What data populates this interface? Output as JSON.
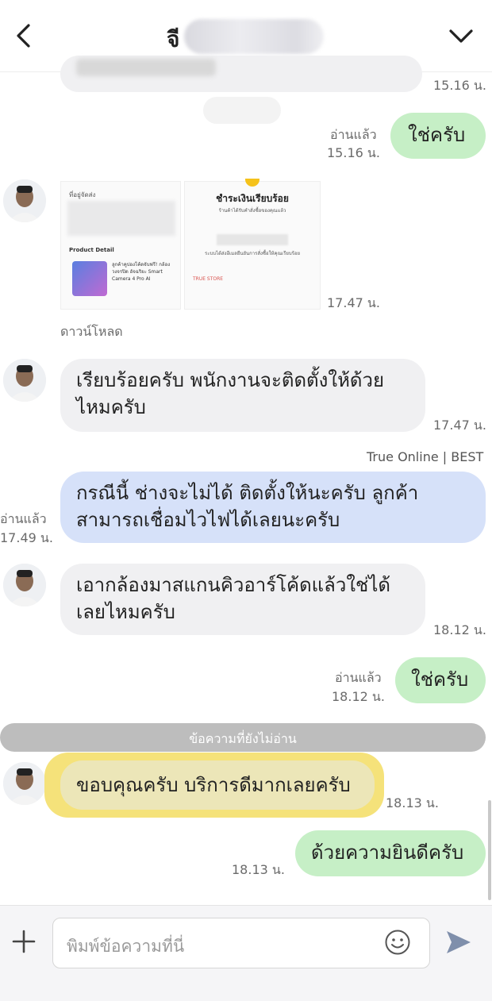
{
  "header": {
    "title_visible": "จี",
    "back_icon": "chevron-left-icon",
    "menu_icon": "chevron-down-icon"
  },
  "messages": {
    "top_partial_time": "15.16 น.",
    "m1": {
      "text": "ใช่ครับ",
      "read": "อ่านแล้ว",
      "time": "15.16 น."
    },
    "images": {
      "time": "17.47 น.",
      "download_label": "ดาวน์โหลด",
      "left_card": {
        "title": "ที่อยู่จัดส่ง",
        "section": "Product Detail",
        "product_name": "ลูกค้าคูปองโค้ดจับฟรี! กล้องวงจรปิด อัจฉริยะ Smart Camera 4 Pro AI"
      },
      "right_card": {
        "title": "ชำระเงินเรียบร้อย",
        "line1": "ร้านค้าได้รับคำสั่งซื้อของคุณแล้ว",
        "line2": "ระบบได้ส่งอีเมลยืนยันการสั่งซื้อให้คุณเรียบร้อย",
        "line3": "TRUE STORE"
      }
    },
    "m2": {
      "text_line1": "เรียบร้อยครับ พนักงานจะติดตั้งให้ด้วย",
      "text_line2": "ไหมครับ",
      "time": "17.47 น."
    },
    "m3": {
      "sender": "True Online | BEST",
      "text_line1": "กรณีนี้ ช่างจะไม่ได้ ติดตั้งให้นะครับ ลูกค้า",
      "text_line2": "สามารถเชื่อมไวไฟได้เลยนะครับ",
      "read": "อ่านแล้ว",
      "time": "17.49 น."
    },
    "m4": {
      "text_line1": "เอากล้องมาสแกนคิวอาร์โค้ดแล้วใช่ได้",
      "text_line2": "เลยไหมครับ",
      "time": "18.12 น."
    },
    "m5": {
      "text": "ใช่ครับ",
      "read": "อ่านแล้ว",
      "time": "18.12 น."
    },
    "unread_divider": "ข้อความที่ยังไม่อ่าน",
    "m6": {
      "text": "ขอบคุณครับ บริการดีมากเลยครับ",
      "time": "18.13 น."
    },
    "m7": {
      "text": "ด้วยความยินดีครับ",
      "time": "18.13 น."
    }
  },
  "composer": {
    "placeholder": "พิมพ์ข้อความที่นี่",
    "add_icon": "plus-icon",
    "emoji_icon": "smiley-icon",
    "send_icon": "send-icon"
  },
  "colors": {
    "green_bubble": "#c6efc6",
    "blue_bubble": "#d6e1f9",
    "gray_bubble": "#f0f0f2",
    "highlight": "#f5e27a"
  }
}
